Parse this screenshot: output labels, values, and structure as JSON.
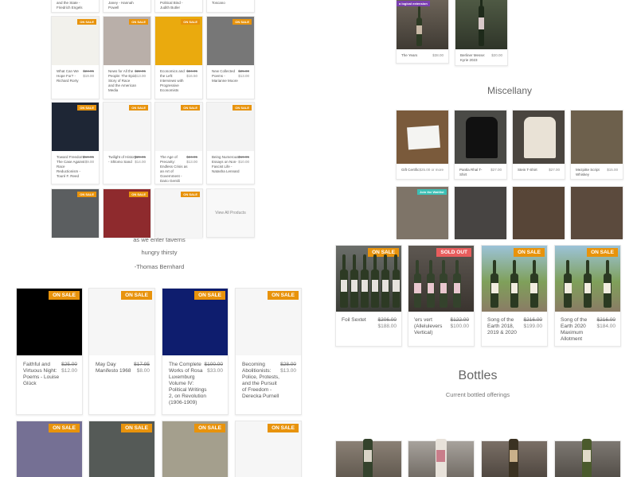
{
  "books_top_row": [
    {
      "title": "and the State - Friedrich Engels"
    },
    {
      "title": "Janey - Hannah Powell"
    },
    {
      "title": "Political Bind - Judith Butler"
    },
    {
      "title": "Toscano"
    }
  ],
  "books_small": [
    {
      "title": "What Can We Hope For? - Richard Rorty",
      "old": "$24.95",
      "now": "$19.00",
      "badge": "ON SALE",
      "color": "#f2f1ec"
    },
    {
      "title": "News for All the People: The Epic Story of Race and the American Media",
      "old": "$22.95",
      "now": "$13.00",
      "badge": "ON SALE",
      "color": "#b9afa9"
    },
    {
      "title": "Economics and the Left: Interviews with Progressive Economists",
      "old": "$24.95",
      "now": "$16.50",
      "badge": "ON SALE",
      "color": "#eaaa0e"
    },
    {
      "title": "New Collected Poems - Marianne Moore",
      "old": "$25.00",
      "now": "$13.00",
      "badge": "ON SALE",
      "color": "#777"
    },
    {
      "title": "Toward Freedom: The Case Against Race Reductionism - Touré F. Reed",
      "old": "$19.95",
      "now": "$9.00",
      "badge": "ON SALE",
      "color": "#1e2635"
    },
    {
      "title": "Twilight of History - Shlomo Sand",
      "old": "$29.95",
      "now": "$14.00",
      "badge": "ON SALE",
      "color": "#f5f5f5"
    },
    {
      "title": "The Age of Precarity: Endless Crisis as an Art of Government - Dario Gentili",
      "old": "$24.95",
      "now": "$13.00",
      "badge": "ON SALE",
      "color": "#f5f5f5"
    },
    {
      "title": "Being Numerous: Essays on Non-Fascist Life - Natasha Lennard",
      "old": "$19.95",
      "now": "$10.00",
      "badge": "ON SALE",
      "color": "#f3f3f3"
    },
    {
      "title": "",
      "old": "",
      "now": "",
      "badge": "ON SALE",
      "color": "#5b5e60"
    },
    {
      "title": "",
      "old": "",
      "now": "",
      "badge": "ON SALE",
      "color": "#8e2a2d"
    },
    {
      "title": "",
      "old": "",
      "now": "",
      "badge": "ON SALE",
      "color": "#f5f5f5"
    }
  ],
  "view_all": "View All Products",
  "quote": {
    "line1": "as we enter taverns",
    "line2": "hungry thirsty",
    "author": "-Thomas Bernhard"
  },
  "books_medium": [
    {
      "title": "Faithful and Virtuous Night: Poems - Louise Glück",
      "old": "$25.00",
      "now": "$12.00",
      "badge": "ON SALE",
      "color": "#000"
    },
    {
      "title": "May Day Manifesto 1968",
      "old": "$17.95",
      "now": "$8.00",
      "badge": "ON SALE",
      "color": "#f6f6f6"
    },
    {
      "title": "The Complete Works of Rosa Luxemburg Volume IV: Political Writings 2, on Revolution (1906-1909)",
      "old": "$100.00",
      "now": "$33.00",
      "badge": "ON SALE",
      "color": "#0e1d6e"
    },
    {
      "title": "Becoming Abolitionists: Police, Protests, and the Pursuit of Freedom - Derecka Purnell",
      "old": "$28.00",
      "now": "$13.00",
      "badge": "ON SALE",
      "color": "#f6f6f6"
    },
    {
      "badge": "ON SALE",
      "color": "#757094"
    },
    {
      "badge": "ON SALE",
      "color": "#555a57"
    },
    {
      "badge": "ON SALE",
      "color": "#a49f8d"
    },
    {
      "badge": "ON SALE",
      "color": "#f6f6f6"
    }
  ],
  "top_right": [
    {
      "title": "The Years",
      "now": "$38.00",
      "badge": "a logical extension"
    },
    {
      "title": "Berliner Messe: Kyrie 2023",
      "now": "$20.00"
    }
  ],
  "miscellany": {
    "heading": "Miscellany",
    "items": [
      {
        "title": "Gift Certific",
        "now": "$25.00 or more"
      },
      {
        "title": "Pantla Rhal T-Shirt",
        "now": "$27.00"
      },
      {
        "title": "Stein T-Shirt",
        "now": "$27.00"
      },
      {
        "title": "Mezpitte Script Whiskey",
        "now": "$15.00"
      }
    ],
    "second_row_badge": "Join the Waitlist"
  },
  "bottles_featured": [
    {
      "title": "Foil Sextet",
      "old": "$206.00",
      "now": "$188.00",
      "badge": "ON SALE"
    },
    {
      "title": "'ers vert (Allelulevers Vertical)",
      "old": "$122.00",
      "now": "$100.00",
      "badge": "SOLD OUT"
    },
    {
      "title": "Song of the Earth 2018, 2019 & 2020",
      "old": "$216.00",
      "now": "$199.00",
      "badge": "ON SALE"
    },
    {
      "title": "Song of the Earth 2020 Maximum Allotment",
      "old": "$216.00",
      "now": "$184.00",
      "badge": "ON SALE"
    }
  ],
  "bottles_section": {
    "heading": "Bottles",
    "subtitle": "Current bottled offerings"
  }
}
